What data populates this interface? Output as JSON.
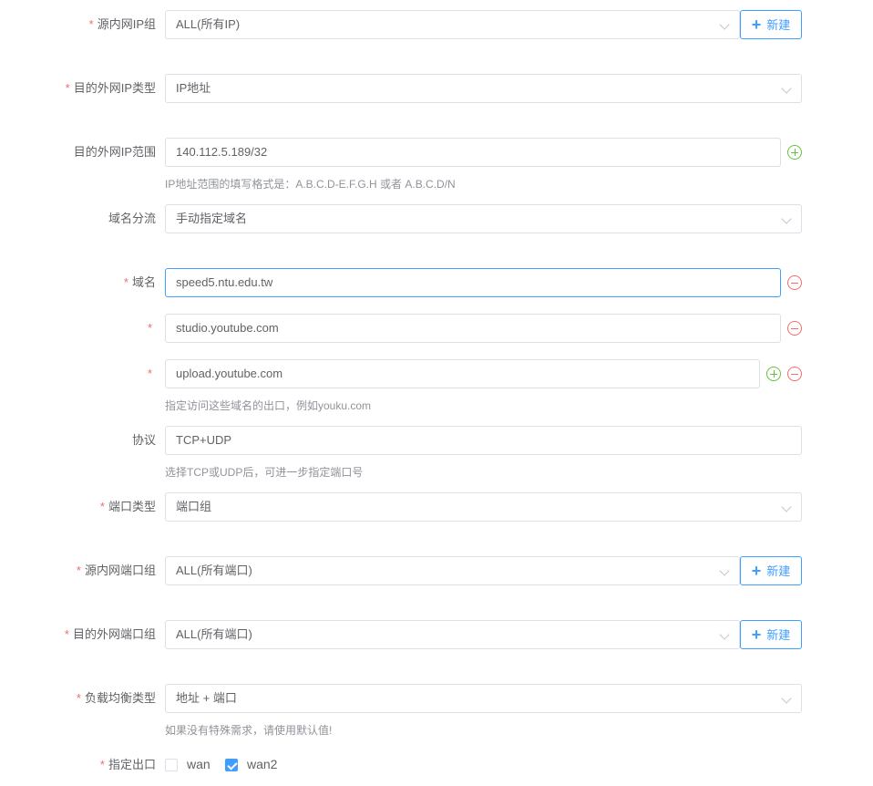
{
  "form": {
    "src_ip_group": {
      "label": "源内网IP组",
      "required": true,
      "value": "ALL(所有IP)",
      "new_button": "新建"
    },
    "dst_ip_type": {
      "label": "目的外网IP类型",
      "required": true,
      "value": "IP地址"
    },
    "dst_ip_range": {
      "label": "目的外网IP范围",
      "required": false,
      "value": "140.112.5.189/32",
      "hint": "IP地址范围的填写格式是：A.B.C.D-E.F.G.H 或者 A.B.C.D/N"
    },
    "domain_split": {
      "label": "域名分流",
      "required": false,
      "value": "手动指定域名"
    },
    "domains": {
      "label": "域名",
      "required_marker": "*",
      "values": [
        "speed5.ntu.edu.tw",
        "studio.youtube.com",
        "upload.youtube.com"
      ],
      "hint": "指定访问这些域名的出口，例如youku.com"
    },
    "protocol": {
      "label": "协议",
      "required": false,
      "value": "TCP+UDP",
      "hint": "选择TCP或UDP后，可进一步指定端口号"
    },
    "port_type": {
      "label": "端口类型",
      "required": true,
      "value": "端口组"
    },
    "src_port_group": {
      "label": "源内网端口组",
      "required": true,
      "value": "ALL(所有端口)",
      "new_button": "新建"
    },
    "dst_port_group": {
      "label": "目的外网端口组",
      "required": true,
      "value": "ALL(所有端口)",
      "new_button": "新建"
    },
    "lb_type": {
      "label": "负载均衡类型",
      "required": true,
      "value": "地址 + 端口",
      "hint": "如果没有特殊需求，请使用默认值!"
    },
    "exit": {
      "label": "指定出口",
      "required": true,
      "options": [
        {
          "label": "wan",
          "checked": false
        },
        {
          "label": "wan2",
          "checked": true
        }
      ]
    }
  },
  "icons": {
    "add": "plus-circle-icon",
    "remove": "minus-circle-icon",
    "dropdown": "chevron-down-icon",
    "plus": "plus-icon"
  },
  "colors": {
    "primary": "#409eff",
    "required": "#f56c6c",
    "add": "#67c23a",
    "remove": "#f56c6c"
  }
}
